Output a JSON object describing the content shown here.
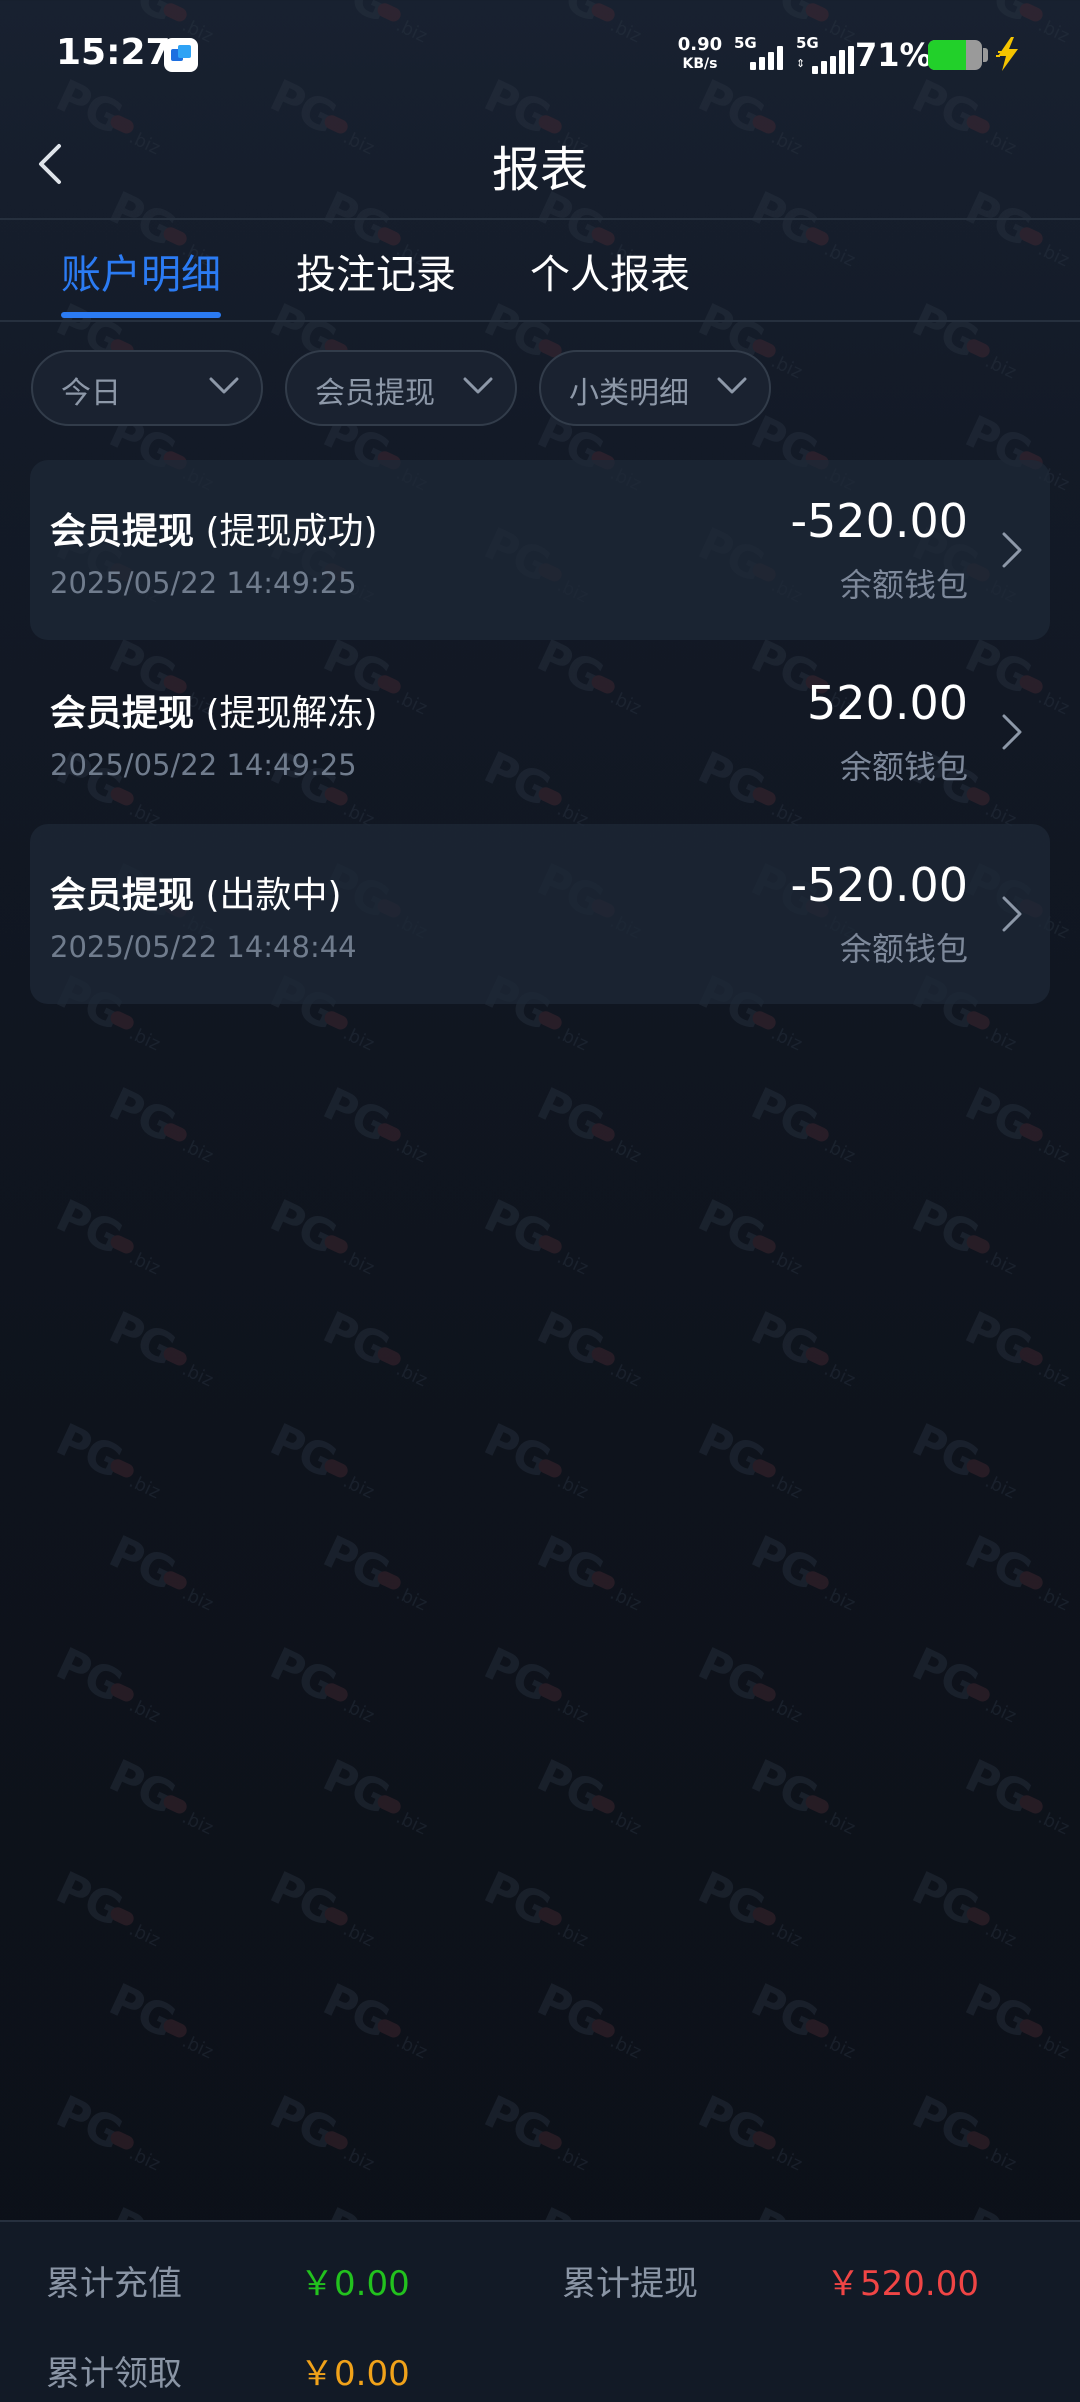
{
  "status_bar": {
    "time": "15:27",
    "net_speed_value": "0.90",
    "net_speed_unit": "KB/s",
    "sim1_label": "5G",
    "sim2_label": "5G",
    "battery_percent": "71%",
    "battery_level": 0.71,
    "icons": [
      "app-notification-icon",
      "signal-icon",
      "battery-icon",
      "charging-bolt-icon"
    ]
  },
  "header": {
    "title": "报表",
    "back_icon": "chevron-left-icon"
  },
  "tabs": [
    {
      "label": "账户明细",
      "active": true
    },
    {
      "label": "投注记录",
      "active": false
    },
    {
      "label": "个人报表",
      "active": false
    }
  ],
  "filters": [
    {
      "label": "今日"
    },
    {
      "label": "会员提现"
    },
    {
      "label": "小类明细"
    }
  ],
  "records": [
    {
      "type": "会员提现",
      "status": "(提现成功)",
      "time": "2025/05/22 14:49:25",
      "amount": "-520.00",
      "wallet": "余额钱包"
    },
    {
      "type": "会员提现",
      "status": "(提现解冻)",
      "time": "2025/05/22 14:49:25",
      "amount": "520.00",
      "wallet": "余额钱包"
    },
    {
      "type": "会员提现",
      "status": "(出款中)",
      "time": "2025/05/22 14:48:44",
      "amount": "-520.00",
      "wallet": "余额钱包"
    }
  ],
  "summary": {
    "total_recharge_label": "累计充值",
    "total_recharge_value": "￥0.00",
    "total_withdraw_label": "累计提现",
    "total_withdraw_value": "￥520.00",
    "total_claim_label": "累计领取",
    "total_claim_value": "￥0.00"
  },
  "watermark": {
    "brand": "PG",
    "suffix": ".biz"
  },
  "colors": {
    "accent": "#2b7bf3",
    "recharge": "#22c21e",
    "withdraw": "#f04545",
    "claim": "#f0a21a"
  }
}
